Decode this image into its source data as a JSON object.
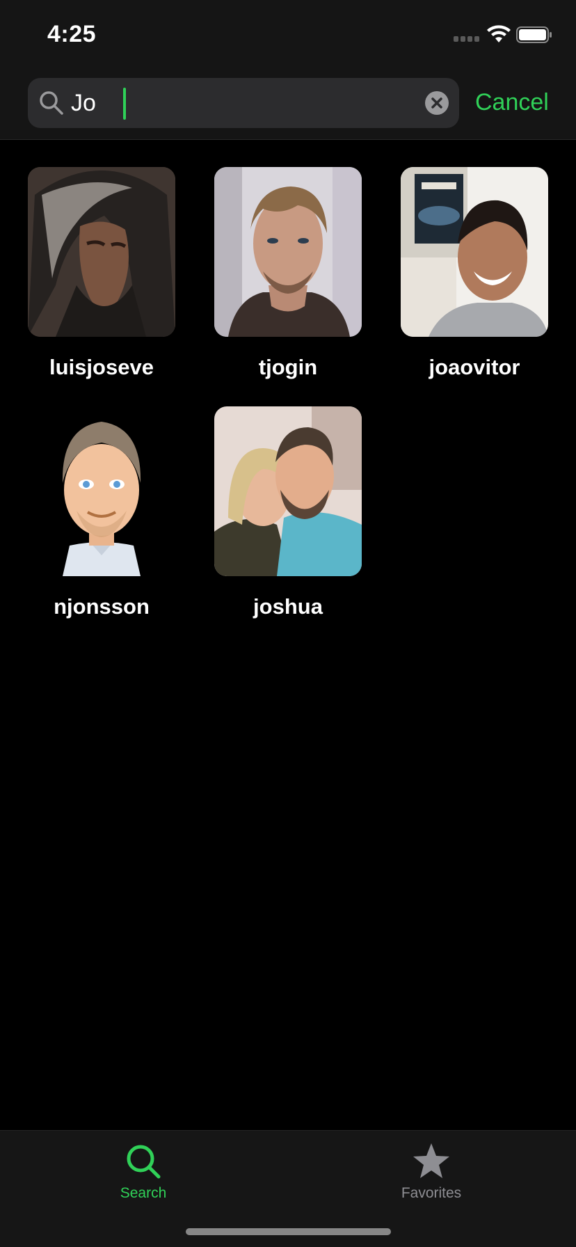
{
  "status_bar": {
    "time": "4:25"
  },
  "search": {
    "query": "Jo",
    "cancel_label": "Cancel"
  },
  "results": [
    {
      "username": "luisjoseve"
    },
    {
      "username": "tjogin"
    },
    {
      "username": "joaovitor"
    },
    {
      "username": "njonsson"
    },
    {
      "username": "joshua"
    }
  ],
  "tab_bar": {
    "search_label": "Search",
    "favorites_label": "Favorites",
    "active": "Search"
  },
  "colors": {
    "accent": "#30d158",
    "inactive": "#8e8e93"
  },
  "icons": [
    "magnifier-icon",
    "clear-icon",
    "star-icon",
    "wifi-icon",
    "battery-icon"
  ]
}
